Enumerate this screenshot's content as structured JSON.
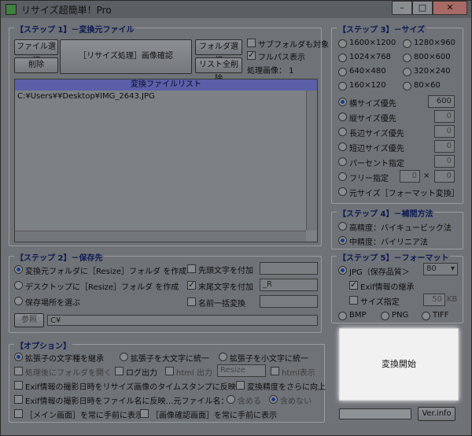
{
  "window": {
    "title": "リサイズ超簡単！Pro",
    "min": "–",
    "max": "□",
    "close": "✕"
  },
  "step1": {
    "title": "【ステップ 1】－変換元ファイル",
    "file_select": "ファイル選択",
    "delete": "削除",
    "resize_confirm": "［リサイズ処理］画像確認",
    "folder_select": "フォルダ選択",
    "list_clear": "リスト全削除",
    "subfolder": "サブフォルダも対象",
    "fullpath": "フルパス表示",
    "processed": "処理画像： 1",
    "list_header": "変換ファイルリスト",
    "files": [
      "C:¥Users¥¥Desktop¥IMG_2643.JPG"
    ]
  },
  "step2": {
    "title": "【ステップ 2】－保存先",
    "opt1": "変換元フォルダに［Resize］フォルダ を作成",
    "opt2": "デスクトップに［Resize］フォルダ を作成",
    "opt3": "保存場所を選ぶ",
    "browse": "参照",
    "path": "C¥",
    "prefix": "先頭文字を付加",
    "suffix": "末尾文字を付加",
    "suffix_value": "_R",
    "rename": "名前一括変換"
  },
  "options": {
    "title": "【オプション】",
    "ext_keep": "拡張子の文字種を継承",
    "ext_upper": "拡張子を大文字に統一",
    "ext_lower": "拡張子を小文字に統一",
    "open_folder": "処理後にフォルダを開く",
    "log": "ログ出力",
    "html_out": "html 出力",
    "html_value": "Resize",
    "html_show": "html表示",
    "exif_ts": "Exif情報の撮影日時をリサイズ画像のタイムスタンプに反映",
    "precision": "変換精度をさらに向上",
    "exif_name": "Exif情報の撮影日時をファイル名に反映…元ファイル名：",
    "include": "含める",
    "exclude": "含めない",
    "main_top": "［メイン画面］を常に手前に表示",
    "preview_top": "［画像確認画面］を常に手前に表示"
  },
  "step3": {
    "title": "【ステップ 3】－サイズ",
    "sizes": [
      "1600×1200",
      "1280×960",
      "1024×768",
      "800×600",
      "640×480",
      "320×240",
      "160×120",
      "80×60"
    ],
    "width_pri": "横サイズ優先",
    "width_val": "600",
    "height_pri": "縦サイズ優先",
    "height_val": "0",
    "long_pri": "長辺サイズ優先",
    "long_val": "0",
    "short_pri": "短辺サイズ優先",
    "short_val": "0",
    "percent": "パーセント指定",
    "percent_val": "0",
    "free": "フリー指定",
    "free_w": "0",
    "free_x": "×",
    "free_h": "0",
    "original": "元サイズ［フォーマット変換］"
  },
  "step4": {
    "title": "【ステップ 4】－補間方法",
    "high": "高精度：バイキュービック法",
    "mid": "中精度：バイリニア法"
  },
  "step5": {
    "title": "【ステップ 5】－フォーマット",
    "jpg": "JPG（保存品質＞",
    "quality": "80",
    "exif_keep": "Exif情報の継承",
    "size_spec": "サイズ指定",
    "size_val": "50",
    "kb": "KB",
    "bmp": "BMP",
    "png": "PNG",
    "tiff": "TIFF"
  },
  "convert": "変換開始",
  "ver": "Ver.info"
}
